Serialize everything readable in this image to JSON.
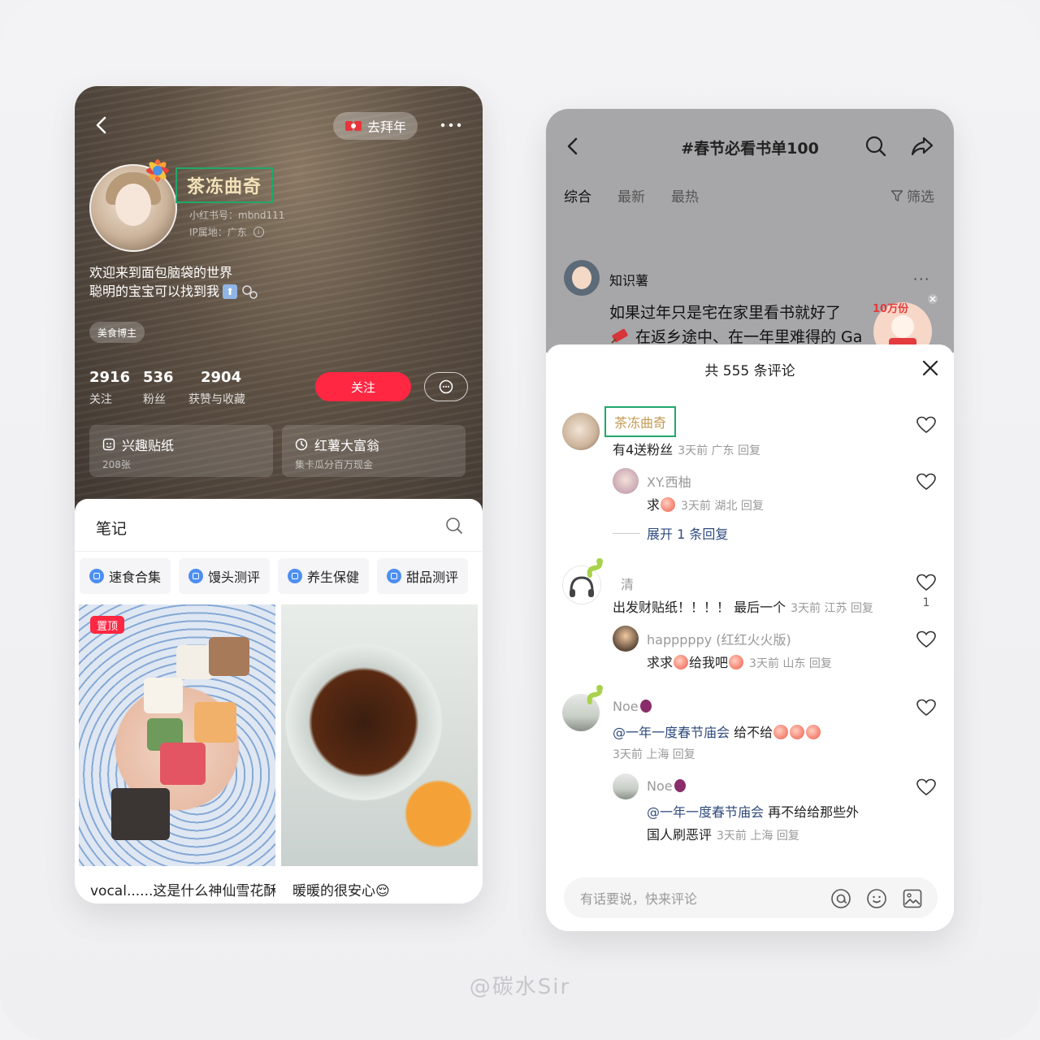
{
  "left_profile": {
    "bainian_label": "去拜年",
    "username": "茶冻曲奇",
    "xhs_id": "小红书号：mbnd111",
    "ip": "IP属地：广东",
    "bio_line1": "欢迎来到面包脑袋的世界",
    "bio_line2": "聪明的宝宝可以找到我",
    "tag": "美食博主",
    "stats": [
      {
        "value": "2916",
        "label": "关注"
      },
      {
        "value": "536",
        "label": "粉丝"
      },
      {
        "value": "2904",
        "label": "获赞与收藏"
      }
    ],
    "follow_label": "关注",
    "cards": [
      {
        "title": "兴趣贴纸",
        "sub": "208张"
      },
      {
        "title": "红薯大富翁",
        "sub": "集卡瓜分百万现金"
      }
    ],
    "notes_title": "笔记",
    "chips": [
      "速食合集",
      "馒头测评",
      "养生保健",
      "甜品测评"
    ],
    "notes": [
      {
        "pin": "置顶",
        "caption": "vocal......这是什么神仙雪花酥"
      },
      {
        "pin": "",
        "caption": "暖暖的很安心😌"
      }
    ]
  },
  "right_topic": {
    "title": "#春节必看书单100",
    "tabs": [
      "综合",
      "最新",
      "最热"
    ],
    "filter_label": "筛选",
    "post_author": "知识薯",
    "post_more": "···",
    "post_line1": "如果过年只是宅在家里看书就好了",
    "post_line2": "在返乡途中、在一年里难得的 Ga",
    "sticker_text": "10万份",
    "comments_title": "共 555 条评论",
    "comments": [
      {
        "name": "茶冻曲奇",
        "body": "有4送粉丝",
        "meta": "3天前 广东 回复"
      },
      {
        "name": "XY.西柚",
        "body": "求",
        "meta": "3天前 湖北 回复"
      },
      {
        "name": "清",
        "body": "出发财贴纸！！！！ 最后一个",
        "meta": "3天前 江苏 回复",
        "likes": "1"
      },
      {
        "name": "happpppy (红红火火版)",
        "body_a": "求求",
        "body_b": "给我吧",
        "meta": "3天前 山东 回复"
      },
      {
        "name": "Noe",
        "mention": "@一年一度春节庙会",
        "body": " 给不给",
        "meta": "3天前 上海 回复"
      },
      {
        "name": "Noe",
        "mention": "@一年一度春节庙会",
        "body": " 再不给给那些外",
        "body2": "国人刷恶评",
        "meta": "3天前 上海 回复"
      }
    ],
    "expand_label": "展开 1 条回复",
    "input_placeholder": "有话要说，快来评论"
  },
  "watermark": "@碳水Sir",
  "colors": {
    "accent_red": "#ff2742",
    "highlight_green": "#1fa86a",
    "mention_blue": "#2f4b7c",
    "gold_name": "#c49a52"
  }
}
